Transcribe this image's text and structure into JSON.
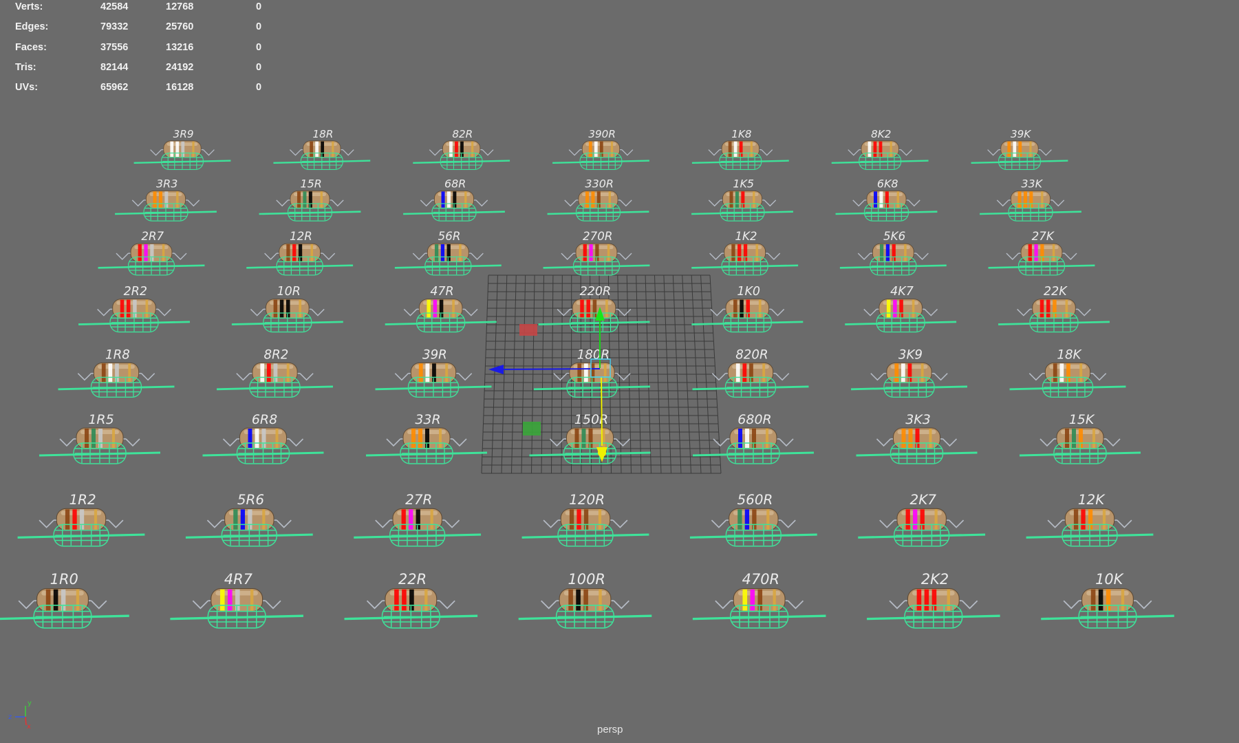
{
  "hud": {
    "rows": [
      {
        "label": "Verts:",
        "a": "42584",
        "b": "12768",
        "c": "0"
      },
      {
        "label": "Edges:",
        "a": "79332",
        "b": "25760",
        "c": "0"
      },
      {
        "label": "Faces:",
        "a": "37556",
        "b": "13216",
        "c": "0"
      },
      {
        "label": "Tris:",
        "a": "82144",
        "b": "24192",
        "c": "0"
      },
      {
        "label": "UVs:",
        "a": "65962",
        "b": "16128",
        "c": "0"
      }
    ]
  },
  "camera_label": "persp",
  "axis": {
    "x": "x",
    "y": "y",
    "z": "z"
  },
  "resistors": [
    {
      "label": "3R9",
      "bands": [
        "#ffffff",
        "#ffffff",
        "#c8c8c8"
      ]
    },
    {
      "label": "18R",
      "bands": [
        "#8b4513",
        "#ffffff",
        "#000000"
      ]
    },
    {
      "label": "82R",
      "bands": [
        "#ffffff",
        "#ff0000",
        "#000000"
      ]
    },
    {
      "label": "390R",
      "bands": [
        "#ff8c00",
        "#ffffff",
        "#8b4513"
      ]
    },
    {
      "label": "1K8",
      "bands": [
        "#8b4513",
        "#ffffff",
        "#ff0000"
      ]
    },
    {
      "label": "8K2",
      "bands": [
        "#ffffff",
        "#ff0000",
        "#ff0000"
      ]
    },
    {
      "label": "39K",
      "bands": [
        "#ff8c00",
        "#ffffff",
        "#ff8c00"
      ]
    },
    {
      "label": "3R3",
      "bands": [
        "#ff8c00",
        "#ff8c00",
        "#c8c8c8"
      ]
    },
    {
      "label": "15R",
      "bands": [
        "#8b4513",
        "#2e8b57",
        "#000000"
      ]
    },
    {
      "label": "68R",
      "bands": [
        "#0000ff",
        "#ffffff",
        "#000000"
      ]
    },
    {
      "label": "330R",
      "bands": [
        "#ff8c00",
        "#ff8c00",
        "#8b4513"
      ]
    },
    {
      "label": "1K5",
      "bands": [
        "#8b4513",
        "#2e8b57",
        "#ff0000"
      ]
    },
    {
      "label": "6K8",
      "bands": [
        "#0000ff",
        "#ffffff",
        "#ff0000"
      ]
    },
    {
      "label": "33K",
      "bands": [
        "#ff8c00",
        "#ff8c00",
        "#ff8c00"
      ]
    },
    {
      "label": "2R7",
      "bands": [
        "#ff0000",
        "#ff00ff",
        "#c8c8c8"
      ]
    },
    {
      "label": "12R",
      "bands": [
        "#8b4513",
        "#ff0000",
        "#000000"
      ]
    },
    {
      "label": "56R",
      "bands": [
        "#2e8b57",
        "#0000ff",
        "#000000"
      ]
    },
    {
      "label": "270R",
      "bands": [
        "#ff0000",
        "#ff00ff",
        "#8b4513"
      ]
    },
    {
      "label": "1K2",
      "bands": [
        "#8b4513",
        "#ff0000",
        "#ff0000"
      ]
    },
    {
      "label": "5K6",
      "bands": [
        "#2e8b57",
        "#0000ff",
        "#ff0000"
      ]
    },
    {
      "label": "27K",
      "bands": [
        "#ff0000",
        "#ff00ff",
        "#ff8c00"
      ]
    },
    {
      "label": "2R2",
      "bands": [
        "#ff0000",
        "#ff0000",
        "#c8c8c8"
      ]
    },
    {
      "label": "10R",
      "bands": [
        "#8b4513",
        "#000000",
        "#000000"
      ]
    },
    {
      "label": "47R",
      "bands": [
        "#ffff00",
        "#ff00ff",
        "#000000"
      ]
    },
    {
      "label": "220R",
      "bands": [
        "#ff0000",
        "#ff0000",
        "#8b4513"
      ]
    },
    {
      "label": "1K0",
      "bands": [
        "#8b4513",
        "#000000",
        "#ff0000"
      ]
    },
    {
      "label": "4K7",
      "bands": [
        "#ffff00",
        "#ff00ff",
        "#ff0000"
      ]
    },
    {
      "label": "22K",
      "bands": [
        "#ff0000",
        "#ff0000",
        "#ff8c00"
      ]
    },
    {
      "label": "1R8",
      "bands": [
        "#8b4513",
        "#ffffff",
        "#c8c8c8"
      ]
    },
    {
      "label": "8R2",
      "bands": [
        "#ffffff",
        "#ff0000",
        "#c8c8c8"
      ]
    },
    {
      "label": "39R",
      "bands": [
        "#ff8c00",
        "#ffffff",
        "#000000"
      ]
    },
    {
      "label": "180R",
      "bands": [
        "#8b4513",
        "#ffffff",
        "#8b4513"
      ]
    },
    {
      "label": "820R",
      "bands": [
        "#ffffff",
        "#ff0000",
        "#8b4513"
      ]
    },
    {
      "label": "3K9",
      "bands": [
        "#ff8c00",
        "#ffffff",
        "#ff0000"
      ]
    },
    {
      "label": "18K",
      "bands": [
        "#8b4513",
        "#ffffff",
        "#ff8c00"
      ]
    },
    {
      "label": "1R5",
      "bands": [
        "#8b4513",
        "#2e8b57",
        "#c8c8c8"
      ]
    },
    {
      "label": "6R8",
      "bands": [
        "#0000ff",
        "#ffffff",
        "#c8c8c8"
      ]
    },
    {
      "label": "33R",
      "bands": [
        "#ff8c00",
        "#ff8c00",
        "#000000"
      ]
    },
    {
      "label": "150R",
      "bands": [
        "#8b4513",
        "#2e8b57",
        "#8b4513"
      ]
    },
    {
      "label": "680R",
      "bands": [
        "#0000ff",
        "#ffffff",
        "#8b4513"
      ]
    },
    {
      "label": "3K3",
      "bands": [
        "#ff8c00",
        "#ff8c00",
        "#ff0000"
      ]
    },
    {
      "label": "15K",
      "bands": [
        "#8b4513",
        "#2e8b57",
        "#ff8c00"
      ]
    },
    {
      "label": "1R2",
      "bands": [
        "#8b4513",
        "#ff0000",
        "#c8c8c8"
      ]
    },
    {
      "label": "5R6",
      "bands": [
        "#2e8b57",
        "#0000ff",
        "#c8c8c8"
      ]
    },
    {
      "label": "27R",
      "bands": [
        "#ff0000",
        "#ff00ff",
        "#000000"
      ]
    },
    {
      "label": "120R",
      "bands": [
        "#8b4513",
        "#ff0000",
        "#8b4513"
      ]
    },
    {
      "label": "560R",
      "bands": [
        "#2e8b57",
        "#0000ff",
        "#8b4513"
      ]
    },
    {
      "label": "2K7",
      "bands": [
        "#ff0000",
        "#ff00ff",
        "#ff0000"
      ]
    },
    {
      "label": "12K",
      "bands": [
        "#8b4513",
        "#ff0000",
        "#ff8c00"
      ]
    },
    {
      "label": "1R0",
      "bands": [
        "#8b4513",
        "#000000",
        "#c8c8c8"
      ]
    },
    {
      "label": "4R7",
      "bands": [
        "#ffff00",
        "#ff00ff",
        "#c8c8c8"
      ]
    },
    {
      "label": "22R",
      "bands": [
        "#ff0000",
        "#ff0000",
        "#000000"
      ]
    },
    {
      "label": "100R",
      "bands": [
        "#8b4513",
        "#000000",
        "#8b4513"
      ]
    },
    {
      "label": "470R",
      "bands": [
        "#ffff00",
        "#ff00ff",
        "#8b4513"
      ]
    },
    {
      "label": "2K2",
      "bands": [
        "#ff0000",
        "#ff0000",
        "#ff0000"
      ]
    },
    {
      "label": "10K",
      "bands": [
        "#8b4513",
        "#000000",
        "#ff8c00"
      ]
    }
  ],
  "colors": {
    "wire": "#3ee39a",
    "body": "#b8946a",
    "background": "#6b6b6b"
  }
}
